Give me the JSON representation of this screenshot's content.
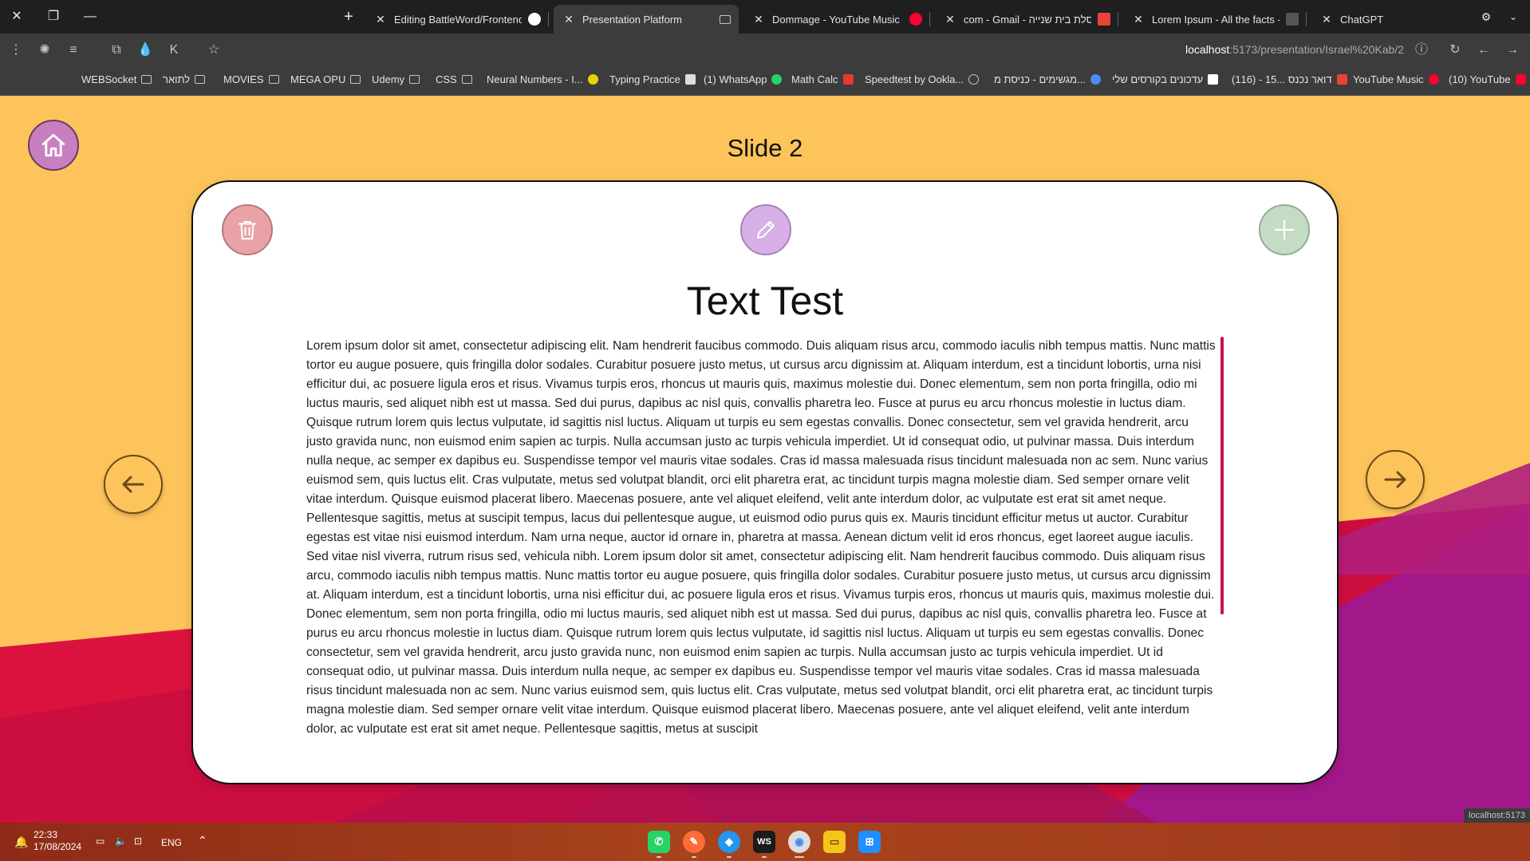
{
  "tabs": [
    {
      "title": "Editing BattleWord/Frontend/B",
      "icon": "github-icon",
      "color": "#ffffff",
      "active": false
    },
    {
      "title": "Presentation Platform",
      "icon": "cast-icon",
      "color": "#c4c7c5",
      "active": true
    },
    {
      "title": "Dommage - YouTube Music",
      "icon": "youtube-music-icon",
      "color": "#ff0033",
      "active": false
    },
    {
      "title": "com - Gmail - מסלת בית שנייה.",
      "icon": "gmail-icon",
      "color": "#ea4335",
      "active": false
    },
    {
      "title": "Lorem Ipsum - All the facts - Lip",
      "icon": "lipsum-icon",
      "color": "#888888",
      "active": false
    },
    {
      "title": "ChatGPT",
      "icon": "chatgpt-icon",
      "color": "#ffffff",
      "active": false
    }
  ],
  "toolbar": {
    "url_host": "localhost",
    "url_path": ":5173/presentation/Israel%20Kab/2"
  },
  "bookmarks": [
    {
      "label": "WEBSocket",
      "kind": "folder"
    },
    {
      "label": "לתואר",
      "kind": "folder"
    },
    {
      "label": "MOVIES",
      "kind": "folder"
    },
    {
      "label": "MEGA OPU",
      "kind": "folder"
    },
    {
      "label": "Udemy",
      "kind": "folder"
    },
    {
      "label": "CSS",
      "kind": "folder"
    },
    {
      "label": "Neural Numbers - I...",
      "kind": "site",
      "color": "#e6d200"
    },
    {
      "label": "Typing Practice",
      "kind": "site",
      "color": "#dddddd"
    },
    {
      "label": "(1) WhatsApp",
      "kind": "site",
      "color": "#25d366"
    },
    {
      "label": "Math Calc",
      "kind": "site",
      "color": "#e53935"
    },
    {
      "label": "Speedtest by Ookla...",
      "kind": "site",
      "color": "#c4c7c5"
    },
    {
      "label": "מגשימים - כניסת מ...",
      "kind": "site",
      "color": "#4a8bf5"
    },
    {
      "label": "עדכונים בקורסים שלי",
      "kind": "site",
      "color": "#ffffff"
    },
    {
      "label": "(116) - 15... דואר נכנס",
      "kind": "site",
      "color": "#ea4335"
    },
    {
      "label": "YouTube Music",
      "kind": "site",
      "color": "#ff0033"
    },
    {
      "label": "(10) YouTube",
      "kind": "site",
      "color": "#ff0033"
    }
  ],
  "page": {
    "slide_label": "Slide 2",
    "text_title": "Text Test",
    "text_body": "Lorem ipsum dolor sit amet, consectetur adipiscing elit. Nam hendrerit faucibus commodo. Duis aliquam risus arcu, commodo iaculis nibh tempus mattis. Nunc mattis tortor eu augue posuere, quis fringilla dolor sodales. Curabitur posuere justo metus, ut cursus arcu dignissim at. Aliquam interdum, est a tincidunt lobortis, urna nisi efficitur dui, ac posuere ligula eros et risus. Vivamus turpis eros, rhoncus ut mauris quis, maximus molestie dui. Donec elementum, sem non porta fringilla, odio mi luctus mauris, sed aliquet nibh est ut massa. Sed dui purus, dapibus ac nisl quis, convallis pharetra leo. Fusce at purus eu arcu rhoncus molestie in luctus diam. Quisque rutrum lorem quis lectus vulputate, id sagittis nisl luctus. Aliquam ut turpis eu sem egestas convallis. Donec consectetur, sem vel gravida hendrerit, arcu justo gravida nunc, non euismod enim sapien ac turpis. Nulla accumsan justo ac turpis vehicula imperdiet. Ut id consequat odio, ut pulvinar massa. Duis interdum nulla neque, ac semper ex dapibus eu. Suspendisse tempor vel mauris vitae sodales. Cras id massa malesuada risus tincidunt malesuada non ac sem. Nunc varius euismod sem, quis luctus elit. Cras vulputate, metus sed volutpat blandit, orci elit pharetra erat, ac tincidunt turpis magna molestie diam. Sed semper ornare velit vitae interdum. Quisque euismod placerat libero. Maecenas posuere, ante vel aliquet eleifend, velit ante interdum dolor, ac vulputate est erat sit amet neque. Pellentesque sagittis, metus at suscipit tempus, lacus dui pellentesque augue, ut euismod odio purus quis ex. Mauris tincidunt efficitur metus ut auctor. Curabitur egestas est vitae nisi euismod interdum. Nam urna neque, auctor id ornare in, pharetra at massa. Aenean dictum velit id eros rhoncus, eget laoreet augue iaculis. Sed vitae nisl viverra, rutrum risus sed, vehicula nibh. Lorem ipsum dolor sit amet, consectetur adipiscing elit. Nam hendrerit faucibus commodo. Duis aliquam risus arcu, commodo iaculis nibh tempus mattis. Nunc mattis tortor eu augue posuere, quis fringilla dolor sodales. Curabitur posuere justo metus, ut cursus arcu dignissim at. Aliquam interdum, est a tincidunt lobortis, urna nisi efficitur dui, ac posuere ligula eros et risus. Vivamus turpis eros, rhoncus ut mauris quis, maximus molestie dui. Donec elementum, sem non porta fringilla, odio mi luctus mauris, sed aliquet nibh est ut massa. Sed dui purus, dapibus ac nisl quis, convallis pharetra leo. Fusce at purus eu arcu rhoncus molestie in luctus diam. Quisque rutrum lorem quis lectus vulputate, id sagittis nisl luctus. Aliquam ut turpis eu sem egestas convallis. Donec consectetur, sem vel gravida hendrerit, arcu justo gravida nunc, non euismod enim sapien ac turpis. Nulla accumsan justo ac turpis vehicula imperdiet. Ut id consequat odio, ut pulvinar massa. Duis interdum nulla neque, ac semper ex dapibus eu. Suspendisse tempor vel mauris vitae sodales. Cras id massa malesuada risus tincidunt malesuada non ac sem. Nunc varius euismod sem, quis luctus elit. Cras vulputate, metus sed volutpat blandit, orci elit pharetra erat, ac tincidunt turpis magna molestie diam. Sed semper ornare velit vitae interdum. Quisque euismod placerat libero. Maecenas posuere, ante vel aliquet eleifend, velit ante interdum dolor, ac vulputate est erat sit amet neque. Pellentesque sagittis, metus at suscipit",
    "status_url": "localhost:5173"
  },
  "taskbar": {
    "time": "22:33",
    "date": "17/08/2024",
    "language": "ENG",
    "apps": [
      {
        "name": "whatsapp-icon",
        "color": "#25d366",
        "glyph": "✆"
      },
      {
        "name": "postman-icon",
        "color": "#ff6c37",
        "glyph": "✎"
      },
      {
        "name": "docker-icon",
        "color": "#2496ed",
        "glyph": "◆"
      },
      {
        "name": "webstorm-icon",
        "color": "#1b1b1b",
        "glyph": "WS"
      },
      {
        "name": "chrome-icon",
        "color": "#dddddd",
        "glyph": "◉"
      },
      {
        "name": "file-explorer-icon",
        "color": "#f5c518",
        "glyph": "▭"
      },
      {
        "name": "windows-icon",
        "color": "#1e90ff",
        "glyph": "⊞"
      }
    ]
  },
  "colors": {
    "page_bg": "#fdc45b",
    "delete": "#e9a3a6",
    "edit": "#d6b0e6",
    "add": "#c3dcc3",
    "home": "#c77fc0",
    "scrollbar": "#c7144e"
  }
}
